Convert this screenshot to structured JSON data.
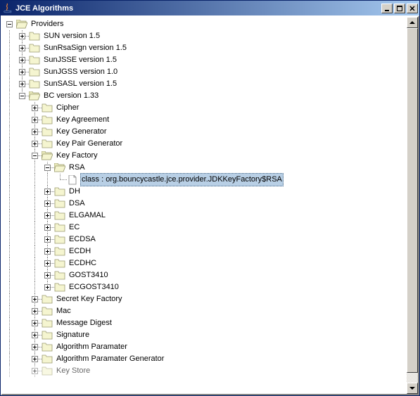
{
  "window": {
    "title": "JCE Algorithms",
    "icons": {
      "app": "java-cup-icon",
      "minimize": "minimize-icon",
      "maximize": "maximize-icon",
      "close": "close-icon"
    }
  },
  "tree": {
    "root": {
      "label": "Providers"
    },
    "providers": [
      {
        "label": "SUN version 1.5"
      },
      {
        "label": "SunRsaSign version 1.5"
      },
      {
        "label": "SunJSSE version 1.5"
      },
      {
        "label": "SunJGSS version 1.0"
      },
      {
        "label": "SunSASL version 1.5"
      },
      {
        "label": "BC version 1.33"
      }
    ],
    "bc_children": [
      {
        "label": "Cipher"
      },
      {
        "label": "Key Agreement"
      },
      {
        "label": "Key Generator"
      },
      {
        "label": "Key Pair Generator"
      },
      {
        "label": "Key Factory"
      },
      {
        "label": "Secret Key Factory"
      },
      {
        "label": "Mac"
      },
      {
        "label": "Message Digest"
      },
      {
        "label": "Signature"
      },
      {
        "label": "Algorithm Paramater"
      },
      {
        "label": "Algorithm Paramater Generator"
      },
      {
        "label": "Key Store"
      }
    ],
    "keyfactory_children": [
      {
        "label": "RSA"
      },
      {
        "label": "DH"
      },
      {
        "label": "DSA"
      },
      {
        "label": "ELGAMAL"
      },
      {
        "label": "EC"
      },
      {
        "label": "ECDSA"
      },
      {
        "label": "ECDH"
      },
      {
        "label": "ECDHC"
      },
      {
        "label": "GOST3410"
      },
      {
        "label": "ECGOST3410"
      }
    ],
    "rsa_leaf": {
      "label": "class : org.bouncycastle.jce.provider.JDKKeyFactory$RSA"
    }
  }
}
